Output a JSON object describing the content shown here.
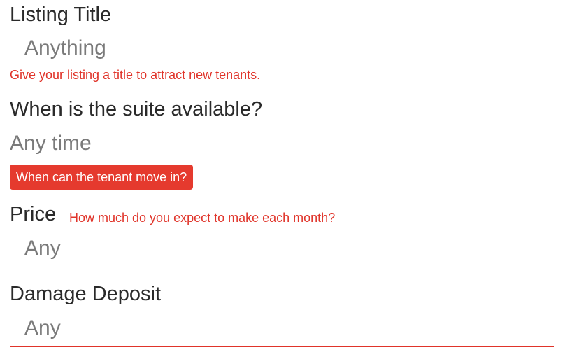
{
  "listing_title": {
    "label": "Listing Title",
    "value": "Anything",
    "hint": "Give your listing a title to attract new tenants."
  },
  "availability": {
    "label": "When is the suite available?",
    "value": "Any time",
    "hint": "When can the tenant move in?"
  },
  "price": {
    "label": "Price",
    "hint": "How much do you expect to make each month?",
    "value": "Any"
  },
  "damage_deposit": {
    "label": "Damage Deposit",
    "value": "Any"
  },
  "colors": {
    "accent": "#e0342a",
    "badge_bg": "#e53a2e",
    "label": "#2a2a2a",
    "value": "#7a7a7a"
  }
}
